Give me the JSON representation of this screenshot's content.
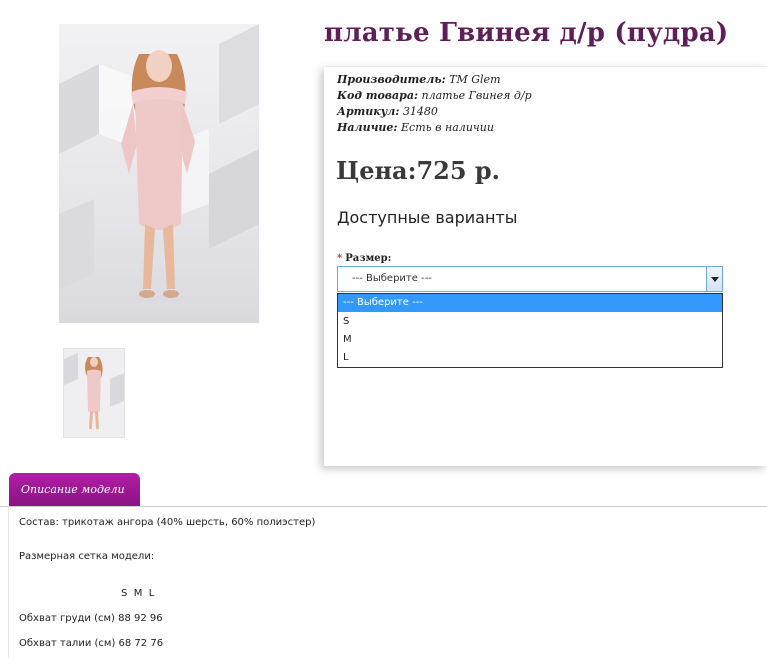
{
  "product": {
    "title": "платье Гвинея д/р (пудра)",
    "manufacturer_label": "Производитель:",
    "manufacturer_value": "ТМ Glem",
    "code_label": "Код товара:",
    "code_value": "платье Гвинея д/р",
    "sku_label": "Артикул:",
    "sku_value": "31480",
    "availability_label": "Наличие:",
    "availability_value": "Есть в наличии",
    "price": "Цена:725 р."
  },
  "variants": {
    "heading": "Доступные варианты",
    "required_mark": "*",
    "size_label": "Размер:",
    "selected": "--- Выберите ---",
    "options": [
      "--- Выберите ---",
      "S",
      "M",
      "L"
    ]
  },
  "tabs": {
    "description_label": "Описание модели"
  },
  "description": {
    "composition": "Состав: трикотаж ангора (40% шерсть, 60% полиэстер)",
    "size_chart_title": "Размерная сетка модели:",
    "size_header": "S  M  L",
    "bust": "Обхват груди (см) 88 92 96",
    "waist": "Обхват талии (см) 68 72 76"
  },
  "colors": {
    "title": "#5e1e58",
    "tab": "#9b1890",
    "dropdown_highlight": "#3399ff",
    "select_border": "#7aa7d8",
    "dress": "#efc9c8"
  }
}
